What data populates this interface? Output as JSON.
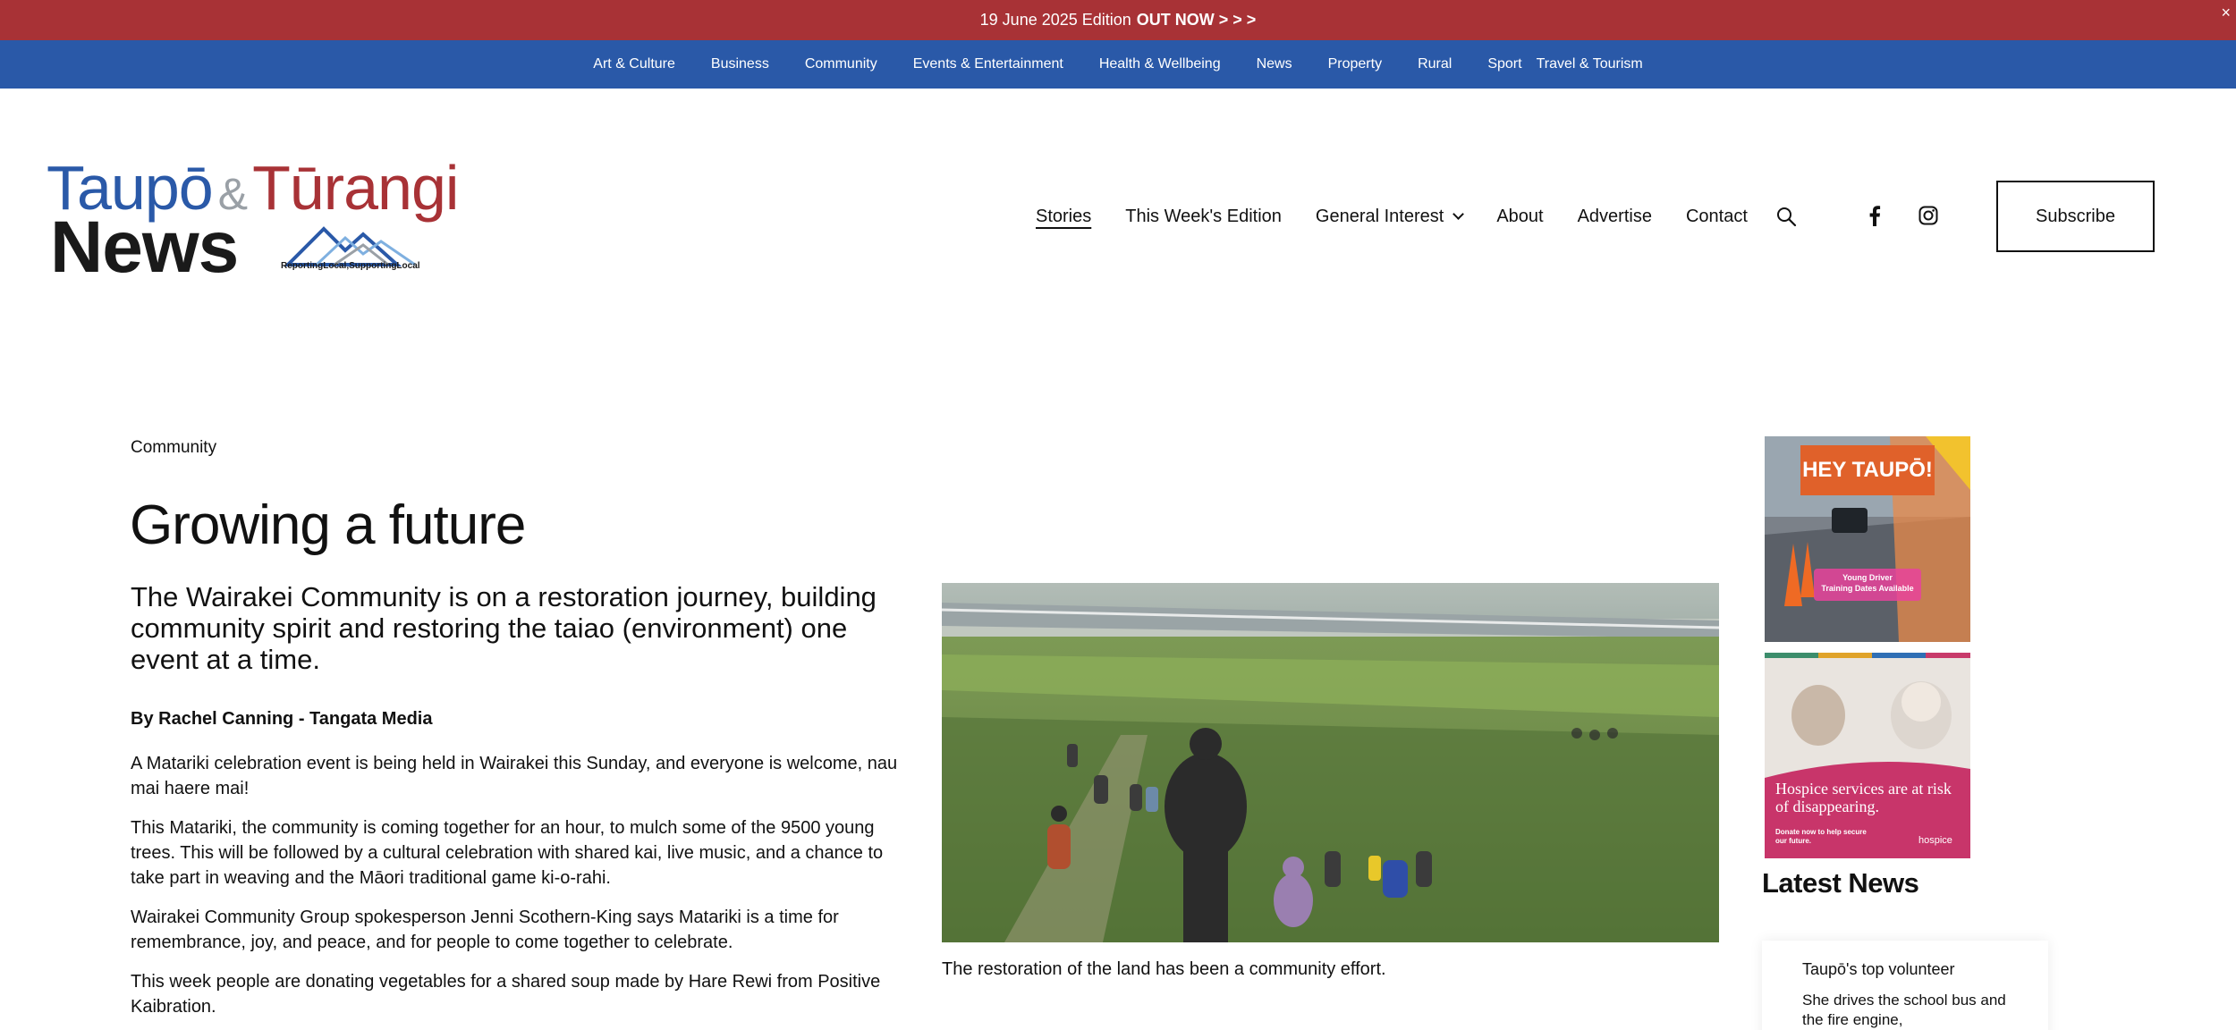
{
  "announcement": {
    "date_text": "19 June 2025 Edition",
    "cta": "OUT NOW > > >",
    "close_glyph": "×"
  },
  "category_nav": [
    "Art & Culture",
    "Business",
    "Community",
    "Events & Entertainment",
    "Health & Wellbeing",
    "News",
    "Property",
    "Rural",
    "Sport",
    "Travel & Tourism"
  ],
  "logo": {
    "line1_a": "Taupō",
    "line1_amp": "&",
    "line1_b": "Tūrangi",
    "line2": "News",
    "tagline": "ReportingLocal,SupportingLocal"
  },
  "main_nav": {
    "stories": "Stories",
    "edition": "This Week's Edition",
    "general_interest": "General Interest",
    "about": "About",
    "advertise": "Advertise",
    "contact": "Contact"
  },
  "header_icons": [
    "search-icon",
    "facebook-icon",
    "instagram-icon"
  ],
  "subscribe_label": "Subscribe",
  "article": {
    "category": "Community",
    "title": "Growing a future",
    "lede": "The Wairakei Community is on a restoration journey, building community spirit and restoring the taiao (environment) one event at a time.",
    "byline": "By Rachel Canning - Tangata Media",
    "paragraphs": [
      "A Matariki celebration event is being held in Wairakei this Sunday, and everyone is welcome, nau mai haere mai!",
      "This Matariki, the community is coming together for an hour, to mulch some of the 9500 young trees. This will be followed by a cultural celebration with shared kai, live music, and a chance to take part in weaving and the Māori traditional game ki-o-rahi.",
      "Wairakei Community Group spokesperson Jenni Scothern-King says Matariki is a time for remembrance, joy, and peace, and for people to come together to celebrate.",
      "This week people are donating vegetables for a shared soup made by Hare Rewi from Positive Kaibration."
    ],
    "caption": "The restoration of the land has been a community effort."
  },
  "sidebar": {
    "ad1": {
      "headline": "HEY TAUPŌ!",
      "badge_line1": "Young Driver",
      "badge_line2": "Training Dates Available"
    },
    "ad2": {
      "headline": "Hospice services are at risk of disappearing.",
      "sub": "Donate now to help secure our future.",
      "brand": "hospice"
    },
    "latest_title": "Latest News",
    "latest_items": [
      {
        "title": "Taupō's top volunteer",
        "desc": "She drives the school bus and the fire engine,"
      }
    ]
  },
  "colors": {
    "announce_bg": "#a83236",
    "nav_bg": "#2a59a8",
    "brand_blue": "#2a59a8",
    "brand_red": "#a83236"
  }
}
